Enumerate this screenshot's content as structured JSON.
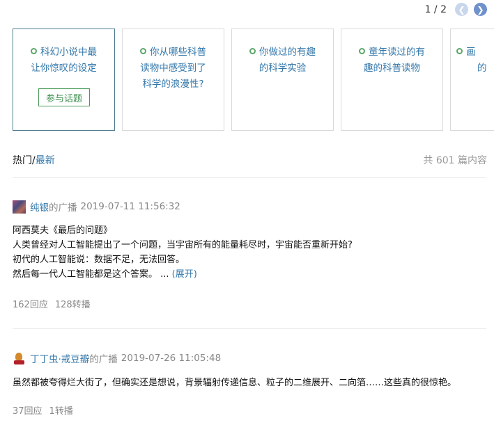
{
  "pager": {
    "text": "1 / 2",
    "prev_icon": "chevron-left-icon",
    "next_icon": "chevron-right-icon"
  },
  "topics": [
    {
      "title": "科幻小说中最让你惊叹的设定",
      "lines": [
        "科幻小说中最",
        "让你惊叹的设定"
      ],
      "active": true,
      "join_label": "参与话题"
    },
    {
      "title": "你从哪些科普读物中感受到了科学的浪漫性？",
      "lines": [
        "你从哪些科普",
        "读物中感受到了",
        "科学的浪漫性?"
      ]
    },
    {
      "title": "你做过的有趣的科学实验",
      "lines": [
        "你做过的有趣",
        "的科学实验"
      ]
    },
    {
      "title": "童年读过的有趣的科普读物",
      "lines": [
        "童年读过的有",
        "趣的科普读物"
      ]
    },
    {
      "title": "画...的...",
      "lines": [
        "画",
        "的"
      ]
    }
  ],
  "tabs": {
    "hot": "热门",
    "sep": "/",
    "latest": "最新"
  },
  "count": "共 601 篇内容",
  "posts": [
    {
      "user": "纯银",
      "action": "的广播",
      "time": "2019-07-11 11:56:32",
      "lines": [
        "阿西莫夫《最后的问题》",
        "人类曾经对人工智能提出了一个问题，当宇宙所有的能量耗尽时，宇宙能否重新开始?",
        "初代的人工智能说：数据不足，无法回答。",
        "然后每一代人工智能都是这个答案。 ..."
      ],
      "expand": "(展开)",
      "replies": "162回应",
      "reposts": "128转播"
    },
    {
      "user": "丁丁虫·戒豆瓣",
      "action": "的广播",
      "time": "2019-07-26 11:05:48",
      "lines": [
        "虽然都被夸得烂大街了，但确实还是想说，背景辐射传递信息、粒子的二维展开、二向箔……这些真的很惊艳。"
      ],
      "replies": "37回应",
      "reposts": "1转播"
    }
  ]
}
